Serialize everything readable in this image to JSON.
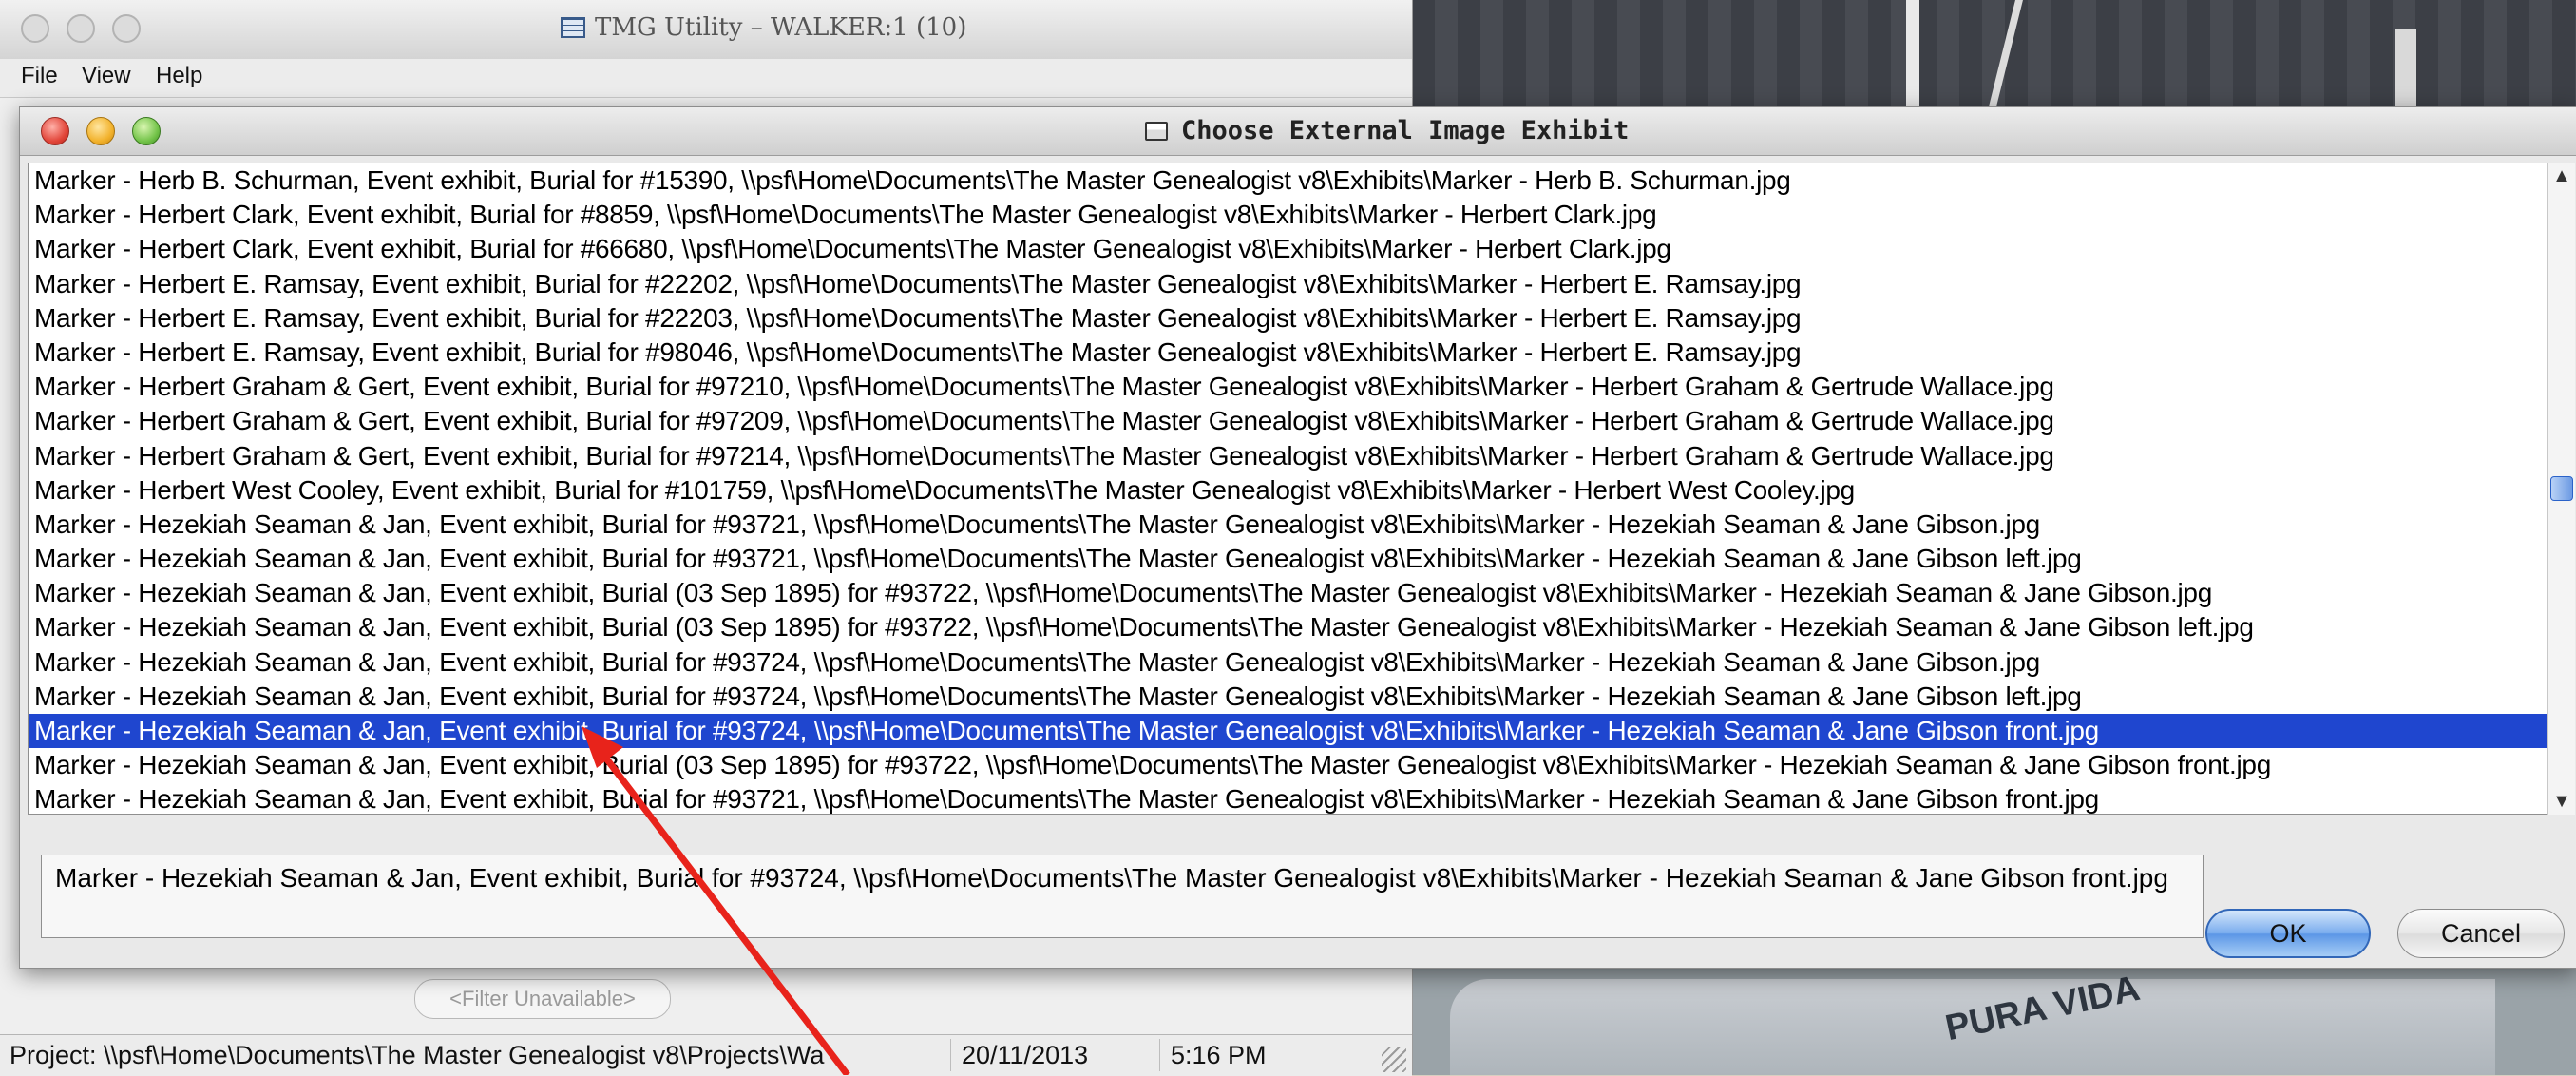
{
  "main_window": {
    "title": "TMG Utility – WALKER:1 (10)",
    "menu": [
      "File",
      "View",
      "Help"
    ],
    "filter_button": "<Filter Unavailable>",
    "status": {
      "project": "Project: \\\\psf\\Home\\Documents\\The Master Genealogist v8\\Projects\\Wa",
      "date": "20/11/2013",
      "time": "5:16 PM"
    }
  },
  "photo": {
    "text": "PURA VIDA"
  },
  "dialog": {
    "title": "Choose External Image Exhibit",
    "selected_index": 16,
    "items": [
      "Marker - Herb B. Schurman, Event exhibit, Burial for #15390, \\\\psf\\Home\\Documents\\The Master Genealogist v8\\Exhibits\\Marker - Herb B. Schurman.jpg",
      "Marker - Herbert Clark, Event exhibit, Burial for #8859, \\\\psf\\Home\\Documents\\The Master Genealogist v8\\Exhibits\\Marker - Herbert Clark.jpg",
      "Marker - Herbert Clark, Event exhibit, Burial for #66680, \\\\psf\\Home\\Documents\\The Master Genealogist v8\\Exhibits\\Marker - Herbert Clark.jpg",
      "Marker - Herbert E. Ramsay, Event exhibit, Burial for #22202, \\\\psf\\Home\\Documents\\The Master Genealogist v8\\Exhibits\\Marker - Herbert E. Ramsay.jpg",
      "Marker - Herbert E. Ramsay, Event exhibit, Burial for #22203, \\\\psf\\Home\\Documents\\The Master Genealogist v8\\Exhibits\\Marker - Herbert E. Ramsay.jpg",
      "Marker - Herbert E. Ramsay, Event exhibit, Burial for #98046, \\\\psf\\Home\\Documents\\The Master Genealogist v8\\Exhibits\\Marker - Herbert E. Ramsay.jpg",
      "Marker - Herbert Graham & Gert, Event exhibit, Burial for #97210, \\\\psf\\Home\\Documents\\The Master Genealogist v8\\Exhibits\\Marker - Herbert Graham & Gertrude Wallace.jpg",
      "Marker - Herbert Graham & Gert, Event exhibit, Burial for #97209, \\\\psf\\Home\\Documents\\The Master Genealogist v8\\Exhibits\\Marker - Herbert Graham & Gertrude Wallace.jpg",
      "Marker - Herbert Graham & Gert, Event exhibit, Burial for #97214, \\\\psf\\Home\\Documents\\The Master Genealogist v8\\Exhibits\\Marker - Herbert Graham & Gertrude Wallace.jpg",
      "Marker - Herbert West Cooley, Event exhibit, Burial for #101759, \\\\psf\\Home\\Documents\\The Master Genealogist v8\\Exhibits\\Marker - Herbert West Cooley.jpg",
      "Marker - Hezekiah Seaman & Jan, Event exhibit, Burial for #93721, \\\\psf\\Home\\Documents\\The Master Genealogist v8\\Exhibits\\Marker - Hezekiah Seaman & Jane Gibson.jpg",
      "Marker - Hezekiah Seaman & Jan, Event exhibit, Burial for #93721, \\\\psf\\Home\\Documents\\The Master Genealogist v8\\Exhibits\\Marker - Hezekiah Seaman & Jane Gibson left.jpg",
      "Marker - Hezekiah Seaman & Jan, Event exhibit, Burial (03 Sep 1895) for #93722, \\\\psf\\Home\\Documents\\The Master Genealogist v8\\Exhibits\\Marker - Hezekiah Seaman & Jane Gibson.jpg",
      "Marker - Hezekiah Seaman & Jan, Event exhibit, Burial (03 Sep 1895) for #93722, \\\\psf\\Home\\Documents\\The Master Genealogist v8\\Exhibits\\Marker - Hezekiah Seaman & Jane Gibson left.jpg",
      "Marker - Hezekiah Seaman & Jan, Event exhibit, Burial for #93724, \\\\psf\\Home\\Documents\\The Master Genealogist v8\\Exhibits\\Marker - Hezekiah Seaman & Jane Gibson.jpg",
      "Marker - Hezekiah Seaman & Jan, Event exhibit, Burial for #93724, \\\\psf\\Home\\Documents\\The Master Genealogist v8\\Exhibits\\Marker - Hezekiah Seaman & Jane Gibson left.jpg",
      "Marker - Hezekiah Seaman & Jan, Event exhibit, Burial for #93724, \\\\psf\\Home\\Documents\\The Master Genealogist v8\\Exhibits\\Marker - Hezekiah Seaman & Jane Gibson front.jpg",
      "Marker - Hezekiah Seaman & Jan, Event exhibit, Burial (03 Sep 1895) for #93722, \\\\psf\\Home\\Documents\\The Master Genealogist v8\\Exhibits\\Marker - Hezekiah Seaman & Jane Gibson front.jpg",
      "Marker - Hezekiah Seaman & Jan, Event exhibit, Burial for #93721, \\\\psf\\Home\\Documents\\The Master Genealogist v8\\Exhibits\\Marker - Hezekiah Seaman & Jane Gibson front.jpg"
    ],
    "detail_text": "Marker - Hezekiah Seaman & Jan, Event exhibit, Burial for #93724, \\\\psf\\Home\\Documents\\The Master Genealogist v8\\Exhibits\\Marker - Hezekiah Seaman & Jane Gibson front.jpg",
    "ok_label": "OK",
    "cancel_label": "Cancel"
  },
  "colors": {
    "selection": "#1f46cf",
    "annotation_arrow": "#e8231b"
  },
  "icons": [
    "close-light-icon",
    "minimize-light-icon",
    "zoom-light-icon",
    "window-icon",
    "dialog-icon",
    "scroll-up-icon",
    "scroll-down-icon",
    "resize-grip-icon"
  ]
}
